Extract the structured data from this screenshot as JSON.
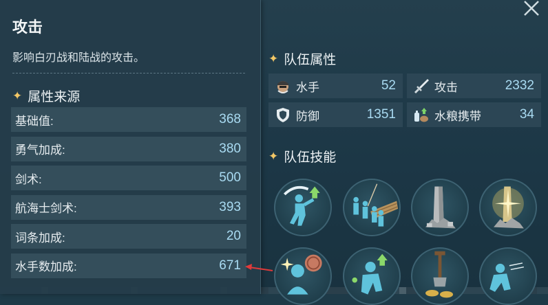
{
  "tooltip": {
    "title": "攻击",
    "description": "影响白刃战和陆战的攻击。",
    "source_heading": "属性来源",
    "rows": [
      {
        "label": "基础值:",
        "value": "368"
      },
      {
        "label": "勇气加成:",
        "value": "380"
      },
      {
        "label": "剑术:",
        "value": "500"
      },
      {
        "label": "航海士剑术:",
        "value": "393"
      },
      {
        "label": "词条加成:",
        "value": "20"
      },
      {
        "label": "水手数加成:",
        "value": "671"
      }
    ]
  },
  "team_attributes": {
    "heading": "队伍属性",
    "stats": [
      {
        "icon": "sailor-icon",
        "label": "水手",
        "value": "52"
      },
      {
        "icon": "sword-icon",
        "label": "攻击",
        "value": "2332"
      },
      {
        "icon": "shield-icon",
        "label": "防御",
        "value": "1351"
      },
      {
        "icon": "supplies-icon",
        "label": "水粮携带",
        "value": "34"
      }
    ]
  },
  "team_skills": {
    "heading": "队伍技能",
    "skills": [
      {
        "icon": "slash-attack-up-icon"
      },
      {
        "icon": "crew-boarding-icon"
      },
      {
        "icon": "stone-pillar-icon"
      },
      {
        "icon": "glowing-pillar-icon"
      },
      {
        "icon": "coin-sailor-icon"
      },
      {
        "icon": "crew-morale-up-icon"
      },
      {
        "icon": "treasure-shovel-icon"
      },
      {
        "icon": "moon-dash-icon"
      }
    ]
  },
  "colors": {
    "accent_star": "#f2c766",
    "value_text": "#a9dbf2",
    "pointer_arrow": "#e03a3a"
  }
}
